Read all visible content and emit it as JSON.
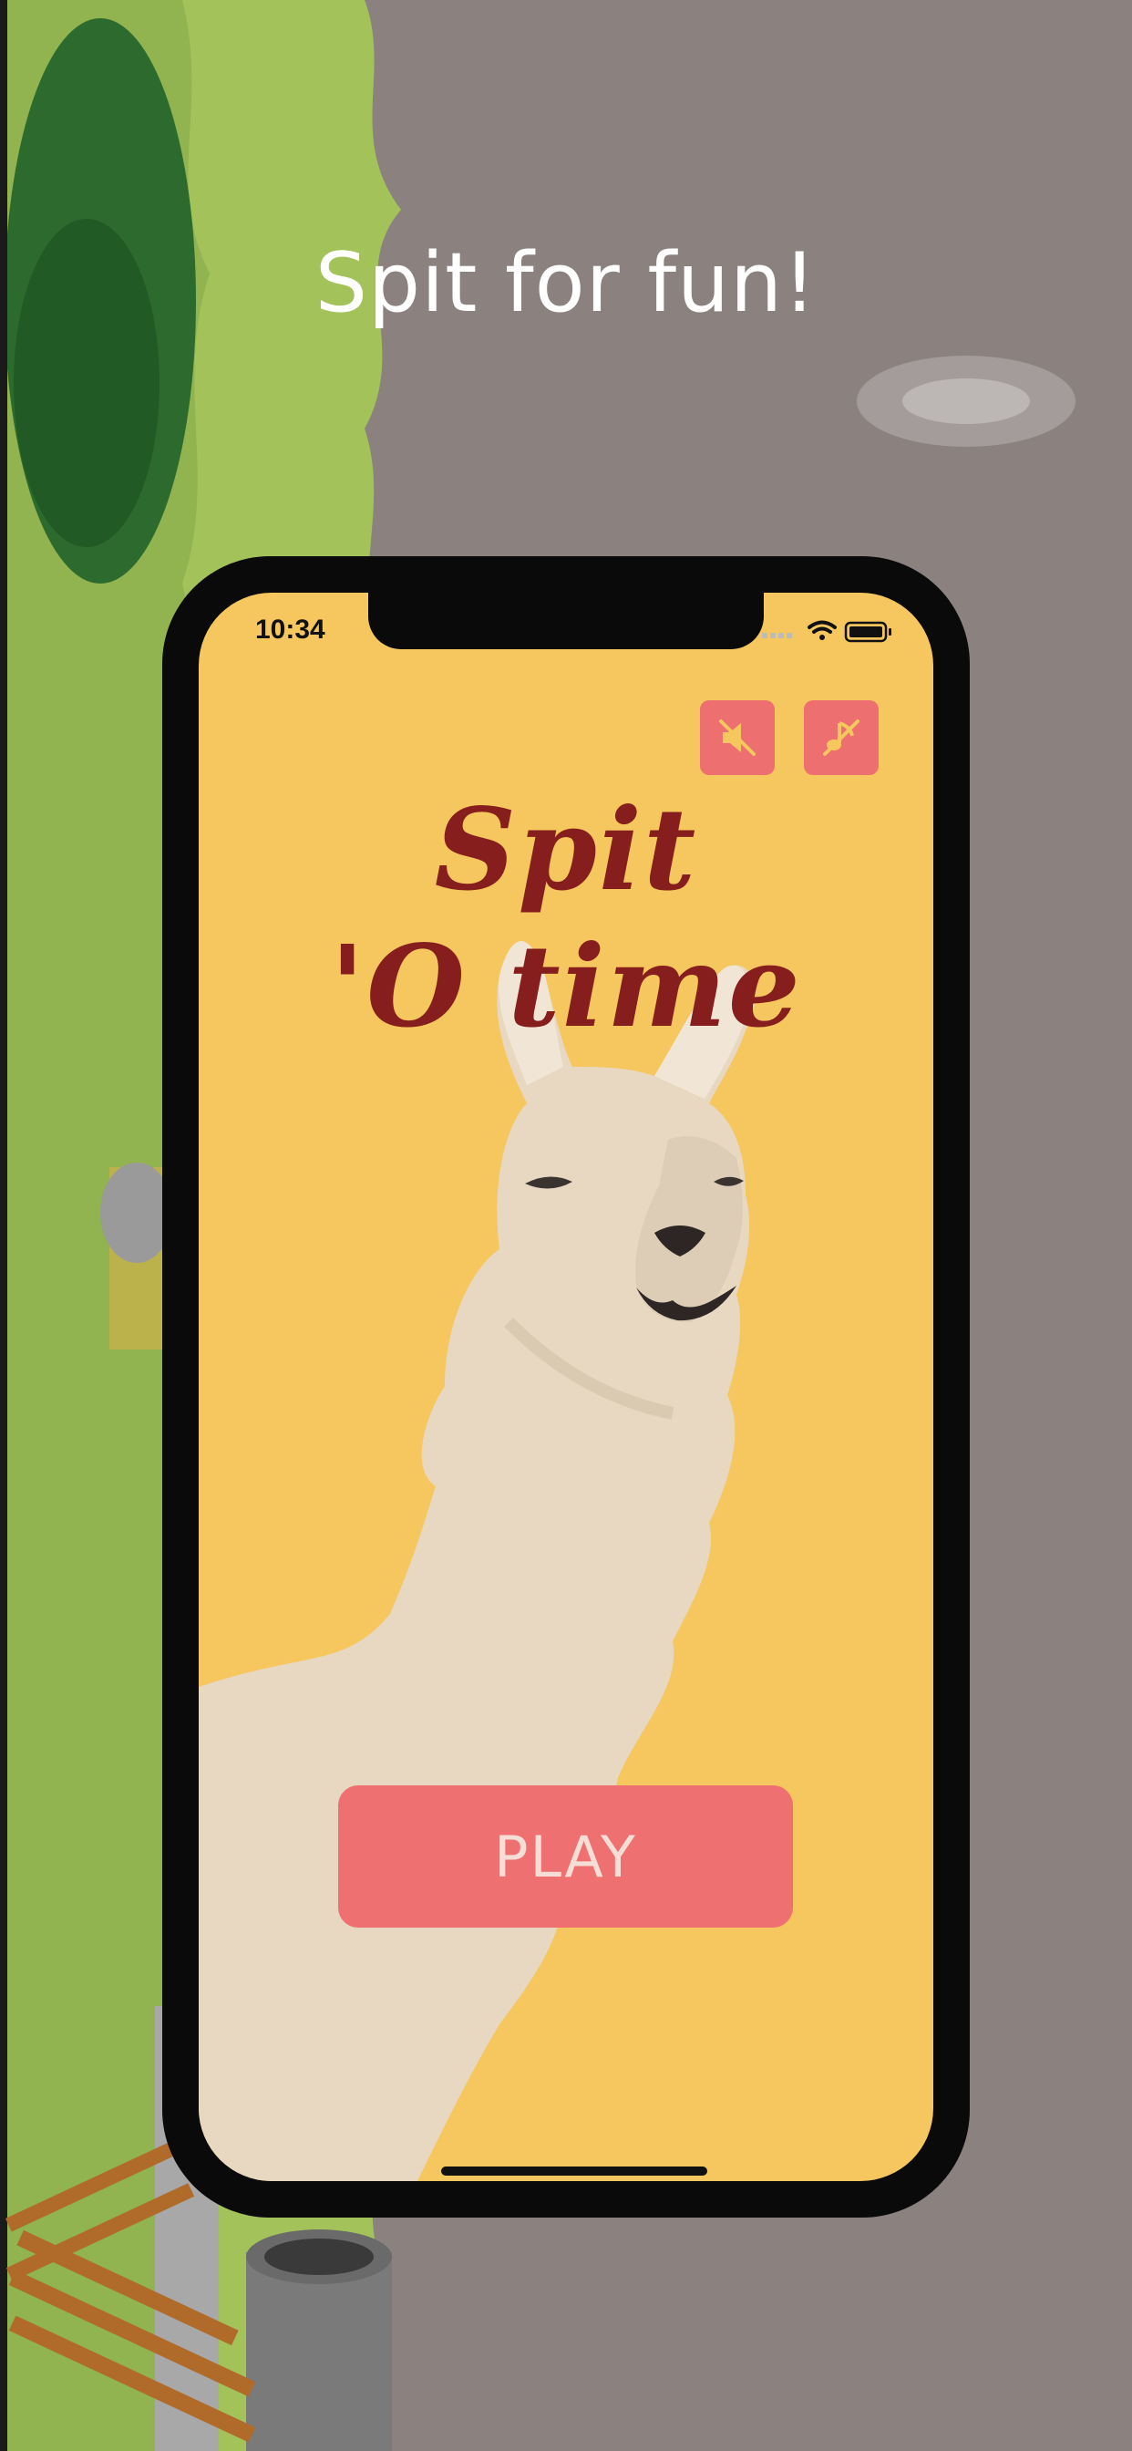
{
  "headline": "Spit for fun!",
  "status_bar": {
    "time": "10:34",
    "icons": [
      "signal-icon",
      "wifi-icon",
      "battery-icon"
    ]
  },
  "game": {
    "title_line1": "Spit",
    "title_line2": "'O time",
    "play_label": "PLAY",
    "mute_sound_icon": "speaker-muted-icon",
    "mute_music_icon": "music-off-icon"
  },
  "colors": {
    "screen_bg": "#f6c75e",
    "title": "#861e1e",
    "button": "#ee7070",
    "llama": "#e8d8c2"
  }
}
